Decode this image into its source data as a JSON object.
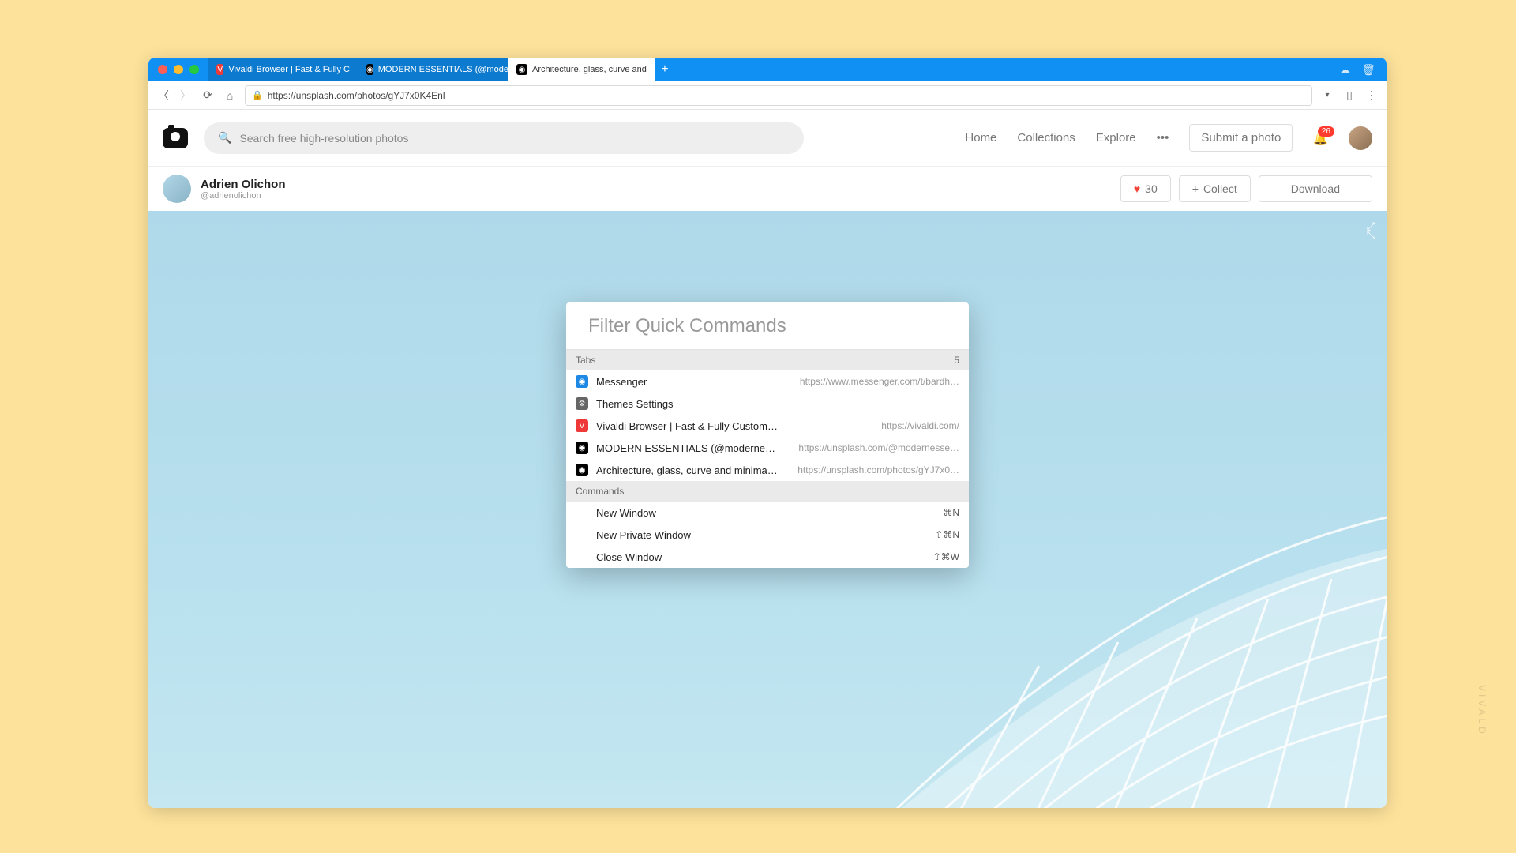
{
  "tabs": [
    {
      "label": "Vivaldi Browser | Fast & Fully C",
      "icon_bg": "#ef3939",
      "icon_txt": "V"
    },
    {
      "label": "MODERN ESSENTIALS (@mode",
      "icon_bg": "#000",
      "icon_txt": "◉"
    },
    {
      "label": "Architecture, glass, curve and",
      "icon_bg": "#000",
      "icon_txt": "◉",
      "active": true
    }
  ],
  "address_url": "https://unsplash.com/photos/gYJ7x0K4Enl",
  "search_placeholder": "Search free high-resolution photos",
  "nav": {
    "home": "Home",
    "collections": "Collections",
    "explore": "Explore"
  },
  "submit_label": "Submit a photo",
  "notif_count": "26",
  "author": {
    "name": "Adrien Olichon",
    "handle": "@adrienolichon"
  },
  "actions": {
    "likes": "30",
    "collect": "Collect",
    "download": "Download"
  },
  "qc": {
    "placeholder": "Filter Quick Commands",
    "tabs_header": "Tabs",
    "tabs_count": "5",
    "items": [
      {
        "label": "Messenger",
        "url": "https://www.messenger.com/t/bardh…",
        "icon_bg": "#1e88e5",
        "icon_txt": "◉"
      },
      {
        "label": "Themes Settings",
        "url": "",
        "icon_bg": "#666",
        "icon_txt": "⚙"
      },
      {
        "label": "Vivaldi Browser | Fast & Fully Customiza…",
        "url": "https://vivaldi.com/",
        "icon_bg": "#ef3939",
        "icon_txt": "V"
      },
      {
        "label": "MODERN ESSENTIALS (@modernessenti…",
        "url": "https://unsplash.com/@modernesse…",
        "icon_bg": "#000",
        "icon_txt": "◉"
      },
      {
        "label": "Architecture, glass, curve and minimal …",
        "url": "https://unsplash.com/photos/gYJ7x0…",
        "icon_bg": "#000",
        "icon_txt": "◉"
      }
    ],
    "commands_header": "Commands",
    "commands": [
      {
        "label": "New Window",
        "shortcut": "⌘N"
      },
      {
        "label": "New Private Window",
        "shortcut": "⇧⌘N"
      },
      {
        "label": "Close Window",
        "shortcut": "⇧⌘W"
      }
    ]
  },
  "watermark": "VIVALDI"
}
